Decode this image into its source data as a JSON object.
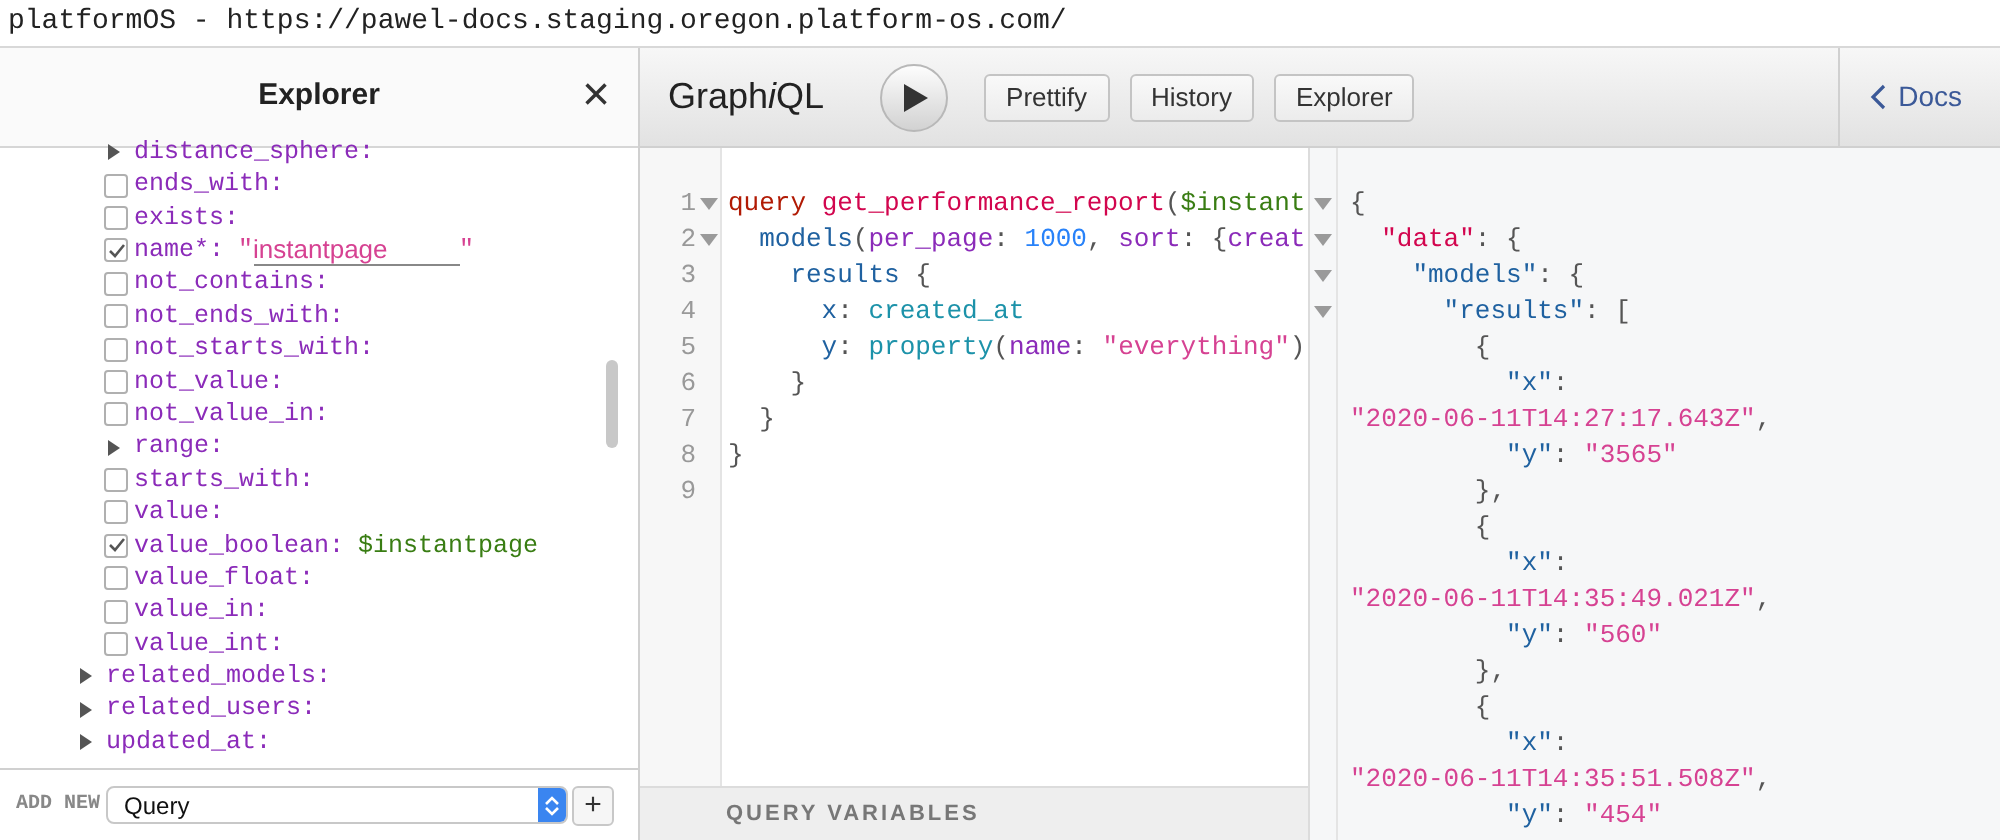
{
  "window": {
    "title": "platformOS - https://pawel-docs.staging.oregon.platform-os.com/"
  },
  "explorer": {
    "title": "Explorer",
    "close": "×",
    "nested_fields": [
      {
        "kind": "arrow",
        "label": "distance_sphere:",
        "expanded": false
      },
      {
        "kind": "checkbox",
        "label": "ends_with:",
        "checked": false
      },
      {
        "kind": "checkbox",
        "label": "exists:",
        "checked": false
      },
      {
        "kind": "checkbox",
        "label": "name*:",
        "checked": true,
        "value": {
          "kind": "string",
          "text": "instantpage",
          "quotes": [
            "\"",
            "\""
          ]
        }
      },
      {
        "kind": "checkbox",
        "label": "not_contains:",
        "checked": false
      },
      {
        "kind": "checkbox",
        "label": "not_ends_with:",
        "checked": false
      },
      {
        "kind": "checkbox",
        "label": "not_starts_with:",
        "checked": false
      },
      {
        "kind": "checkbox",
        "label": "not_value:",
        "checked": false
      },
      {
        "kind": "checkbox",
        "label": "not_value_in:",
        "checked": false
      },
      {
        "kind": "arrow",
        "label": "range:",
        "expanded": false
      },
      {
        "kind": "checkbox",
        "label": "starts_with:",
        "checked": false
      },
      {
        "kind": "checkbox",
        "label": "value:",
        "checked": false
      },
      {
        "kind": "checkbox",
        "label": "value_boolean:",
        "checked": true,
        "value": {
          "kind": "variable",
          "text": "$instantpage"
        }
      },
      {
        "kind": "checkbox",
        "label": "value_float:",
        "checked": false
      },
      {
        "kind": "checkbox",
        "label": "value_in:",
        "checked": false
      },
      {
        "kind": "checkbox",
        "label": "value_int:",
        "checked": false
      }
    ],
    "fields": [
      {
        "kind": "arrow",
        "label": "related_models:",
        "expanded": false
      },
      {
        "kind": "arrow",
        "label": "related_users:",
        "expanded": false
      },
      {
        "kind": "arrow",
        "label": "updated_at:",
        "expanded": false
      }
    ],
    "footer": {
      "label": "ADD NEW",
      "select": "Query",
      "add": "+"
    }
  },
  "toolbar": {
    "logo": {
      "before": "Graph",
      "italic": "i",
      "after": "QL"
    },
    "buttons": [
      "Prettify",
      "History",
      "Explorer"
    ],
    "docs": "Docs"
  },
  "query_editor": {
    "lines": [
      {
        "number": "1",
        "fold": true,
        "tokens": [
          {
            "t": "query ",
            "kind": "keyword"
          },
          {
            "t": "get_performance_report",
            "kind": "def"
          },
          {
            "t": "(",
            "kind": "punct"
          },
          {
            "t": "$instant",
            "kind": "variable"
          }
        ]
      },
      {
        "number": "2",
        "fold": true,
        "tokens": [
          {
            "t": "  models",
            "kind": "property"
          },
          {
            "t": "(",
            "kind": "punct"
          },
          {
            "t": "per_page",
            "kind": "attribute"
          },
          {
            "t": ": ",
            "kind": "punct"
          },
          {
            "t": "1000",
            "kind": "number"
          },
          {
            "t": ", ",
            "kind": "punct"
          },
          {
            "t": "sort",
            "kind": "attribute"
          },
          {
            "t": ": {",
            "kind": "punct"
          },
          {
            "t": "creat",
            "kind": "attribute"
          }
        ]
      },
      {
        "number": "3",
        "fold": false,
        "tokens": [
          {
            "t": "    results",
            "kind": "property"
          },
          {
            "t": " {",
            "kind": "punct"
          }
        ]
      },
      {
        "number": "4",
        "fold": false,
        "tokens": [
          {
            "t": "      x",
            "kind": "property"
          },
          {
            "t": ": ",
            "kind": "punct"
          },
          {
            "t": "created_at",
            "kind": "qualifier"
          }
        ]
      },
      {
        "number": "5",
        "fold": false,
        "tokens": [
          {
            "t": "      y",
            "kind": "property"
          },
          {
            "t": ": ",
            "kind": "punct"
          },
          {
            "t": "property",
            "kind": "qualifier"
          },
          {
            "t": "(",
            "kind": "punct"
          },
          {
            "t": "name",
            "kind": "attribute"
          },
          {
            "t": ": ",
            "kind": "punct"
          },
          {
            "t": "\"everything\"",
            "kind": "string"
          },
          {
            "t": ")",
            "kind": "punct"
          }
        ]
      },
      {
        "number": "6",
        "fold": false,
        "tokens": [
          {
            "t": "    }",
            "kind": "punct"
          }
        ]
      },
      {
        "number": "7",
        "fold": false,
        "tokens": [
          {
            "t": "  }",
            "kind": "punct"
          }
        ]
      },
      {
        "number": "8",
        "fold": false,
        "tokens": [
          {
            "t": "}",
            "kind": "punct"
          }
        ]
      },
      {
        "number": "9",
        "fold": false
      }
    ],
    "variables_title": "QUERY VARIABLES"
  },
  "result": {
    "lines": [
      {
        "fold": true,
        "tokens": [
          {
            "t": "{",
            "kind": "punct"
          }
        ]
      },
      {
        "fold": true,
        "tokens": [
          {
            "t": "  \"data\"",
            "kind": "def"
          },
          {
            "t": ": {",
            "kind": "punct"
          }
        ]
      },
      {
        "fold": true,
        "tokens": [
          {
            "t": "    \"models\"",
            "kind": "property"
          },
          {
            "t": ": {",
            "kind": "punct"
          }
        ]
      },
      {
        "fold": true,
        "tokens": [
          {
            "t": "      \"results\"",
            "kind": "property"
          },
          {
            "t": ": [",
            "kind": "punct"
          }
        ]
      },
      {
        "fold": false,
        "tokens": [
          {
            "t": "        {",
            "kind": "punct"
          }
        ]
      },
      {
        "fold": false,
        "tokens": [
          {
            "t": "          \"x\"",
            "kind": "property"
          },
          {
            "t": ":",
            "kind": "punct"
          }
        ]
      },
      {
        "fold": false,
        "tokens": [
          {
            "t": "\"2020-06-11T14:27:17.643Z\"",
            "kind": "string"
          },
          {
            "t": ",",
            "kind": "punct"
          }
        ]
      },
      {
        "fold": false,
        "tokens": [
          {
            "t": "          \"y\"",
            "kind": "property"
          },
          {
            "t": ": ",
            "kind": "punct"
          },
          {
            "t": "\"3565\"",
            "kind": "string"
          }
        ]
      },
      {
        "fold": false,
        "tokens": [
          {
            "t": "        },",
            "kind": "punct"
          }
        ]
      },
      {
        "fold": false,
        "tokens": [
          {
            "t": "        {",
            "kind": "punct"
          }
        ]
      },
      {
        "fold": false,
        "tokens": [
          {
            "t": "          \"x\"",
            "kind": "property"
          },
          {
            "t": ":",
            "kind": "punct"
          }
        ]
      },
      {
        "fold": false,
        "tokens": [
          {
            "t": "\"2020-06-11T14:35:49.021Z\"",
            "kind": "string"
          },
          {
            "t": ",",
            "kind": "punct"
          }
        ]
      },
      {
        "fold": false,
        "tokens": [
          {
            "t": "          \"y\"",
            "kind": "property"
          },
          {
            "t": ": ",
            "kind": "punct"
          },
          {
            "t": "\"560\"",
            "kind": "string"
          }
        ]
      },
      {
        "fold": false,
        "tokens": [
          {
            "t": "        },",
            "kind": "punct"
          }
        ]
      },
      {
        "fold": false,
        "tokens": [
          {
            "t": "        {",
            "kind": "punct"
          }
        ]
      },
      {
        "fold": false,
        "tokens": [
          {
            "t": "          \"x\"",
            "kind": "property"
          },
          {
            "t": ":",
            "kind": "punct"
          }
        ]
      },
      {
        "fold": false,
        "tokens": [
          {
            "t": "\"2020-06-11T14:35:51.508Z\"",
            "kind": "string"
          },
          {
            "t": ",",
            "kind": "punct"
          }
        ]
      },
      {
        "fold": false,
        "tokens": [
          {
            "t": "          \"y\"",
            "kind": "property"
          },
          {
            "t": ": ",
            "kind": "punct"
          },
          {
            "t": "\"454\"",
            "kind": "string"
          }
        ]
      }
    ]
  }
}
